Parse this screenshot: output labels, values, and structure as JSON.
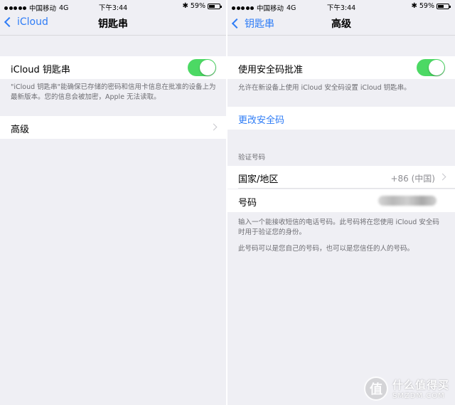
{
  "status_bar": {
    "carrier": "中国移动",
    "network": "4G",
    "time": "下午3:44",
    "battery_text": "59%",
    "battery_level": 0.59
  },
  "left_screen": {
    "nav": {
      "back_label": "iCloud",
      "title": "钥匙串"
    },
    "toggle_row": {
      "label": "iCloud 钥匙串",
      "on": true
    },
    "footnote": "\"iCloud 钥匙串\"能确保已存储的密码和信用卡信息在批准的设备上为最新版本。您的信息会被加密，Apple 无法读取。",
    "advanced_row": {
      "label": "高级"
    }
  },
  "right_screen": {
    "nav": {
      "back_label": "钥匙串",
      "title": "高级"
    },
    "toggle_row": {
      "label": "使用安全码批准",
      "on": true
    },
    "toggle_footnote": "允许在新设备上使用 iCloud 安全码设置 iCloud 钥匙串。",
    "change_code_link": "更改安全码",
    "section_header": "验证号码",
    "country_row": {
      "label": "国家/地区",
      "value": "+86 (中国)"
    },
    "number_row": {
      "label": "号码"
    },
    "footnote_1": "输入一个能接收短信的电话号码。此号码将在您使用 iCloud 安全码时用于验证您的身份。",
    "footnote_2": "此号码可以是您自己的号码，也可以是您信任的人的号码。"
  },
  "watermark": {
    "badge": "值",
    "text_cn": "什么值得买",
    "text_en": "SMZDM.COM"
  },
  "colors": {
    "accent": "#2e7cf6",
    "toggle_on": "#4cd964",
    "background": "#efeff4"
  }
}
